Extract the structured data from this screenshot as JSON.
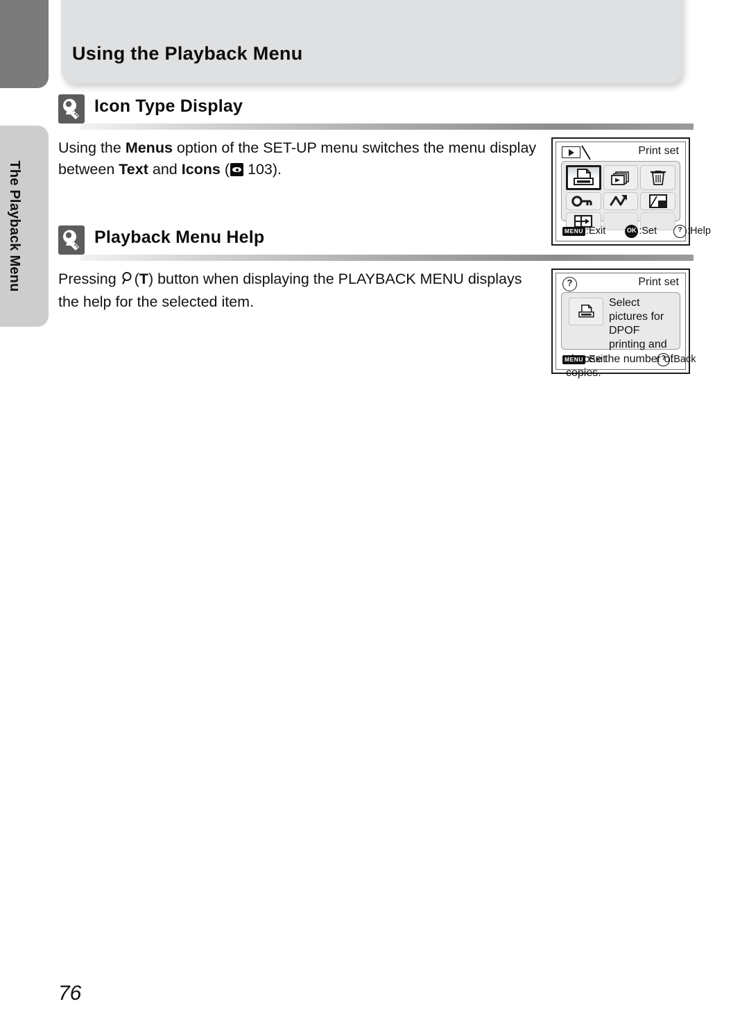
{
  "chapter_tab": {
    "label": "The Playback Menu"
  },
  "header": {
    "title": "Using the Playback Menu"
  },
  "sections": [
    {
      "icon": "tip-lightbulb-icon",
      "title": "Icon Type Display",
      "text_part1": "Using the ",
      "bold1": "Menus",
      "text_part2": " option of the SET-UP menu switches the menu display between ",
      "bold2": "Text",
      "text_part3": " and ",
      "bold3": "Icons",
      "text_part4": " (",
      "ref_icon": "page-reference-icon",
      "ref_page": "103",
      "text_part5": ")."
    },
    {
      "icon": "tip-lightbulb-icon",
      "title": "Playback Menu Help",
      "text_part1": "Pressing ",
      "glyph": "magnifier-zoom-icon",
      "bold1": "T",
      "text_part2": ") button when displaying the PLAYBACK MENU displays the help for the selected item."
    }
  ],
  "lcd_menu_screen": {
    "tab_icon": "playback-mode-icon",
    "title": "Print set",
    "icons": [
      "print-set-icon",
      "slide-show-icon",
      "delete-trash-icon",
      "protect-key-icon",
      "auto-transfer-icon",
      "small-picture-icon",
      "copy-icon",
      "",
      ""
    ],
    "selected_index": 0,
    "footer": [
      {
        "button": "MENU",
        "label": ":Exit"
      },
      {
        "button": "OK",
        "label": ":Set"
      },
      {
        "button": "?",
        "label": ":Help"
      }
    ]
  },
  "lcd_help_screen": {
    "badge": "?",
    "title": "Print set",
    "icon": "print-set-icon",
    "help_line1": "Select pictures for",
    "help_line2": "DPOF printing and",
    "help_line3": "choose the number of copies.",
    "footer": [
      {
        "button": "MENU",
        "label": ":Exit"
      },
      {
        "button": "?",
        "label": ":Back"
      }
    ]
  },
  "page_number": "76"
}
